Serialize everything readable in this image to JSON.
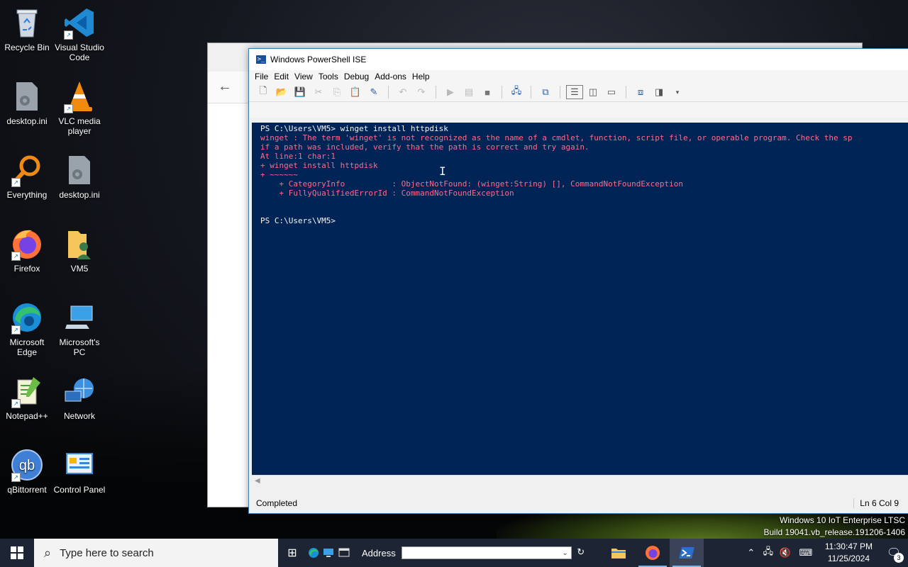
{
  "desktop": {
    "icons": [
      {
        "label": "Recycle Bin",
        "icon": "recycle-bin-icon"
      },
      {
        "label": "Visual Studio Code",
        "icon": "vscode-icon"
      },
      {
        "label": "desktop.ini",
        "icon": "settings-file-icon"
      },
      {
        "label": "VLC media player",
        "icon": "vlc-icon"
      },
      {
        "label": "Everything",
        "icon": "everything-search-icon"
      },
      {
        "label": "desktop.ini",
        "icon": "settings-file-icon"
      },
      {
        "label": "Firefox",
        "icon": "firefox-icon"
      },
      {
        "label": "VM5",
        "icon": "user-folder-icon"
      },
      {
        "label": "Microsoft Edge",
        "icon": "edge-icon"
      },
      {
        "label": "Microsoft's PC",
        "icon": "computer-icon"
      },
      {
        "label": "Notepad++",
        "icon": "notepadpp-icon"
      },
      {
        "label": "Network",
        "icon": "network-icon"
      },
      {
        "label": "qBittorrent",
        "icon": "qbittorrent-icon"
      },
      {
        "label": "Control Panel",
        "icon": "control-panel-icon"
      }
    ]
  },
  "ise": {
    "title": "Windows PowerShell ISE",
    "menu": [
      "File",
      "Edit",
      "View",
      "Tools",
      "Debug",
      "Add-ons",
      "Help"
    ],
    "toolbar": [
      "new-script-icon",
      "open-icon",
      "save-icon",
      "cut-icon",
      "copy-icon",
      "paste-icon",
      "clear-console-icon",
      "undo-icon",
      "redo-icon",
      "run-script-icon",
      "run-selection-icon",
      "stop-icon",
      "new-remote-tab-icon",
      "start-powershell-icon",
      "show-script-top-icon",
      "show-script-right-icon",
      "show-script-maximized-icon",
      "show-command-window-icon",
      "show-command-addon-icon"
    ],
    "console": {
      "lines": [
        {
          "text": "PS C:\\Users\\VM5> winget install httpdisk",
          "kind": "normal"
        },
        {
          "text": "winget : The term 'winget' is not recognized as the name of a cmdlet, function, script file, or operable program. Check the sp",
          "kind": "error"
        },
        {
          "text": "if a path was included, verify that the path is correct and try again.",
          "kind": "error"
        },
        {
          "text": "At line:1 char:1",
          "kind": "error"
        },
        {
          "text": "+ winget install httpdisk",
          "kind": "error"
        },
        {
          "text": "+ ~~~~~~",
          "kind": "error"
        },
        {
          "text": "    + CategoryInfo          : ObjectNotFound: (winget:String) [], CommandNotFoundException",
          "kind": "error"
        },
        {
          "text": "    + FullyQualifiedErrorId : CommandNotFoundException",
          "kind": "error"
        },
        {
          "text": "",
          "kind": "normal"
        },
        {
          "text": "",
          "kind": "normal"
        },
        {
          "text": "PS C:\\Users\\VM5>",
          "kind": "normal"
        }
      ]
    },
    "status": "Completed",
    "position": "Ln 6  Col 9"
  },
  "watermark": {
    "line1": "Windows 10 IoT Enterprise LTSC",
    "line2": "Build 19041.vb_release.191206-1406"
  },
  "taskbar": {
    "search_placeholder": "Type here to search",
    "address_label": "Address",
    "clock_time": "11:30:47 PM",
    "clock_date": "11/25/2024",
    "notification_count": "3"
  },
  "colors": {
    "console_bg": "#012456",
    "console_error": "#ff6b8a",
    "taskbar_bg": "#1d2433"
  }
}
